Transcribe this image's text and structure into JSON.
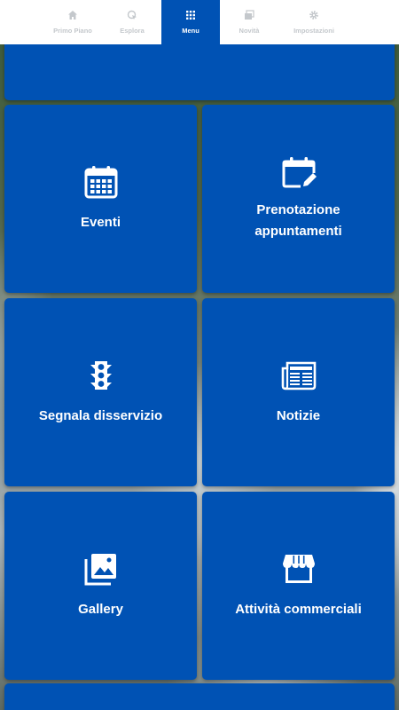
{
  "tabs": [
    {
      "label": "Primo Piano",
      "icon": "home-icon"
    },
    {
      "label": "Esplora",
      "icon": "explore-icon"
    },
    {
      "label": "Menu",
      "icon": "grid-icon",
      "active": true
    },
    {
      "label": "Novità",
      "icon": "news-icon"
    },
    {
      "label": "Impostazioni",
      "icon": "gear-icon"
    }
  ],
  "tiles": [
    {
      "label": "Eventi",
      "icon": "calendar-icon"
    },
    {
      "label": "Prenotazione appuntamenti",
      "icon": "calendar-edit-icon"
    },
    {
      "label": "Segnala disservizio",
      "icon": "traffic-light-icon"
    },
    {
      "label": "Notizie",
      "icon": "newspaper-icon"
    },
    {
      "label": "Gallery",
      "icon": "gallery-icon"
    },
    {
      "label": "Attività commerciali",
      "icon": "storefront-icon"
    }
  ],
  "colors": {
    "tile_blue": "#0052b4",
    "tab_active_bg": "#0052b4",
    "tab_inactive_text": "#c4c8cc",
    "tabbar_bg": "#ffffff"
  }
}
